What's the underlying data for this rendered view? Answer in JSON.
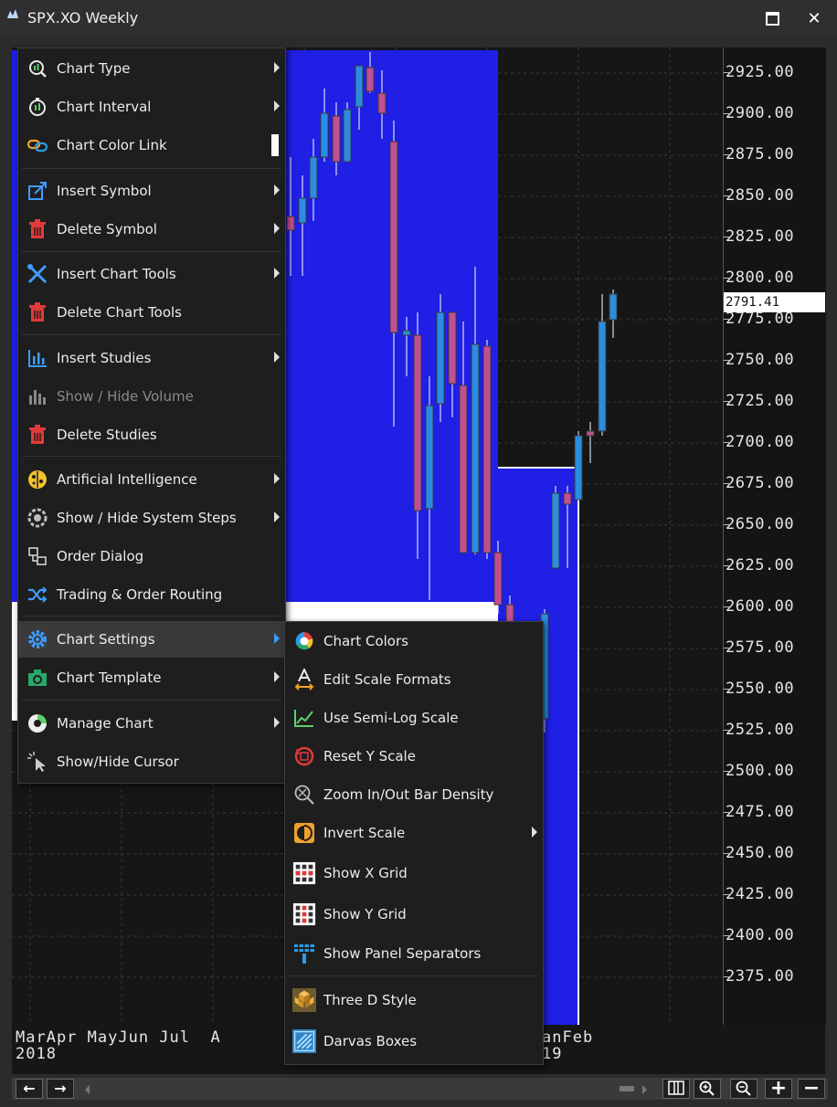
{
  "window": {
    "title": "SPX.XO Weekly",
    "maximize_icon": "maximize-icon",
    "close_icon": "close-icon",
    "close_glyph": "✕"
  },
  "price_axis": {
    "labels": [
      "2925.00",
      "2900.00",
      "2875.00",
      "2850.00",
      "2825.00",
      "2800.00",
      "2775.00",
      "2750.00",
      "2725.00",
      "2700.00",
      "2675.00",
      "2650.00",
      "2625.00",
      "2600.00",
      "2575.00",
      "2550.00",
      "2525.00",
      "2500.00",
      "2475.00",
      "2450.00",
      "2425.00",
      "2400.00",
      "2375.00"
    ],
    "last_price": "2791.41"
  },
  "date_axis": {
    "months_line1": "MarApr MayJun Jul  A",
    "year_line2": "2018",
    "right_line1": "anFeb",
    "right_line2": "19"
  },
  "colors": {
    "darvas_box": "#1f1fe6",
    "up_candle": "#2b8de0",
    "down_candle": "#c2508f",
    "grid": "#3a3a3a"
  },
  "main_menu": {
    "items": [
      {
        "label": "Chart Type",
        "icon": "chart-type-icon",
        "submenu": true
      },
      {
        "label": "Chart Interval",
        "icon": "stopwatch-icon",
        "submenu": true
      },
      {
        "label": "Chart Color Link",
        "icon": "link-icon",
        "toggle": true
      },
      {
        "label": "Insert Symbol",
        "icon": "insert-symbol-icon",
        "submenu": true
      },
      {
        "label": "Delete Symbol",
        "icon": "trash-icon",
        "submenu": true
      },
      {
        "label": "Insert Chart Tools",
        "icon": "tools-icon",
        "submenu": true
      },
      {
        "label": "Delete Chart Tools",
        "icon": "trash-icon"
      },
      {
        "label": "Insert Studies",
        "icon": "studies-icon",
        "submenu": true
      },
      {
        "label": "Show / Hide Volume",
        "icon": "volume-icon",
        "disabled": true
      },
      {
        "label": "Delete Studies",
        "icon": "trash-icon"
      },
      {
        "label": "Artificial Intelligence",
        "icon": "brain-icon",
        "submenu": true
      },
      {
        "label": "Show / Hide System Steps",
        "icon": "system-steps-icon",
        "submenu": true
      },
      {
        "label": "Order Dialog",
        "icon": "order-dialog-icon"
      },
      {
        "label": "Trading & Order Routing",
        "icon": "routing-icon"
      },
      {
        "label": "Chart Settings",
        "icon": "gear-icon",
        "submenu": true,
        "active": true
      },
      {
        "label": "Chart Template",
        "icon": "template-icon",
        "submenu": true
      },
      {
        "label": "Manage Chart",
        "icon": "manage-chart-icon",
        "submenu": true
      },
      {
        "label": "Show/Hide Cursor",
        "icon": "cursor-icon"
      }
    ]
  },
  "settings_submenu": {
    "items": [
      {
        "label": "Chart Colors",
        "icon": "color-wheel-icon"
      },
      {
        "label": "Edit Scale Formats",
        "icon": "scale-format-icon"
      },
      {
        "label": "Use Semi-Log Scale",
        "icon": "semi-log-icon"
      },
      {
        "label": "Reset Y Scale",
        "icon": "reset-scale-icon"
      },
      {
        "label": "Zoom In/Out Bar Density",
        "icon": "zoom-density-icon"
      },
      {
        "label": "Invert Scale",
        "icon": "invert-scale-icon",
        "submenu": true
      },
      {
        "label": "Show X Grid",
        "icon": "x-grid-icon"
      },
      {
        "label": "Show Y Grid",
        "icon": "y-grid-icon"
      },
      {
        "label": "Show Panel Separators",
        "icon": "panel-separator-icon"
      },
      {
        "label": "Three D Style",
        "icon": "three-d-icon"
      },
      {
        "label": "Darvas Boxes",
        "icon": "darvas-icon"
      }
    ]
  },
  "toolbar": {
    "back_glyph": "←",
    "forward_glyph": "→",
    "add_glyph": "+",
    "remove_glyph": "−"
  }
}
